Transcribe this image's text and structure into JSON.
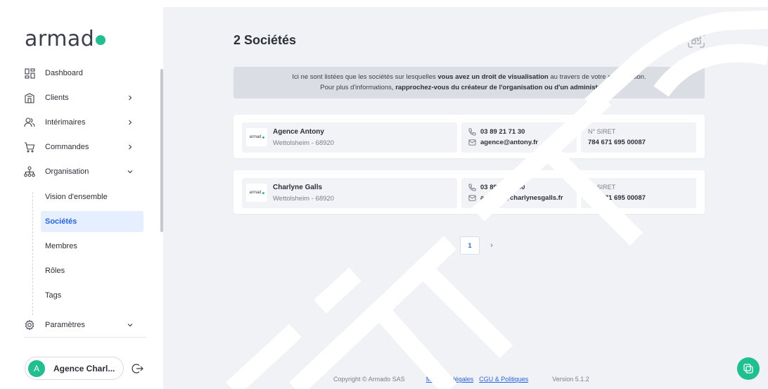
{
  "brand": {
    "logo_text": "armad",
    "accent": "#1fbf8f",
    "link": "#2563eb"
  },
  "sidebar": {
    "items": [
      {
        "label": "Dashboard",
        "icon": "dashboard-icon"
      },
      {
        "label": "Clients",
        "icon": "building-icon",
        "chevron": "right"
      },
      {
        "label": "Intérimaires",
        "icon": "users-icon",
        "chevron": "right"
      },
      {
        "label": "Commandes",
        "icon": "cart-icon",
        "chevron": "right"
      },
      {
        "label": "Organisation",
        "icon": "org-chart-icon",
        "chevron": "down"
      }
    ],
    "subitems": [
      {
        "label": "Vision d'ensemble"
      },
      {
        "label": "Sociétés",
        "active": true
      },
      {
        "label": "Membres"
      },
      {
        "label": "Rôles"
      },
      {
        "label": "Tags"
      }
    ],
    "settings": {
      "label": "Paramètres",
      "icon": "gear-icon",
      "chevron": "down"
    },
    "account": {
      "initial": "A",
      "name": "Agence Charl..."
    }
  },
  "main": {
    "title": "2 Sociétés",
    "banner": {
      "line1_pre": "Ici ne sont listées que les sociétés sur lesquelles ",
      "line1_bold": "vous avez un droit de visualisation",
      "line1_post": " au travers de votre organisation.",
      "line2_pre": "Pour plus d'informations, ",
      "line2_bold": "rapprochez-vous du créateur de l'organisation ou d'un administrateur."
    },
    "companies": [
      {
        "logo_text": "armad",
        "name": "Agence Antony",
        "address": "Wettolsheim - 68920",
        "phone": "03 89 21 71 30",
        "email": "agence@antony.fr",
        "siret_label": "N° SIRET",
        "siret": "784 671 695 00087"
      },
      {
        "logo_text": "armad",
        "name": "Charlyne Galls",
        "address": "Wettolsheim - 68920",
        "phone": "03 89 21 71 30",
        "email": "agence@charlynesgalls.fr",
        "siret_label": "N° SIRET",
        "siret": "784 671 695 00087"
      }
    ],
    "pagination": {
      "prev": "‹",
      "current": "1",
      "next": "›"
    }
  },
  "footer": {
    "copyright": "Copyright © Armado SAS",
    "legal": "Mentions légales",
    "cgu": "CGU & Politiques",
    "version": "Version 5.1.2"
  }
}
